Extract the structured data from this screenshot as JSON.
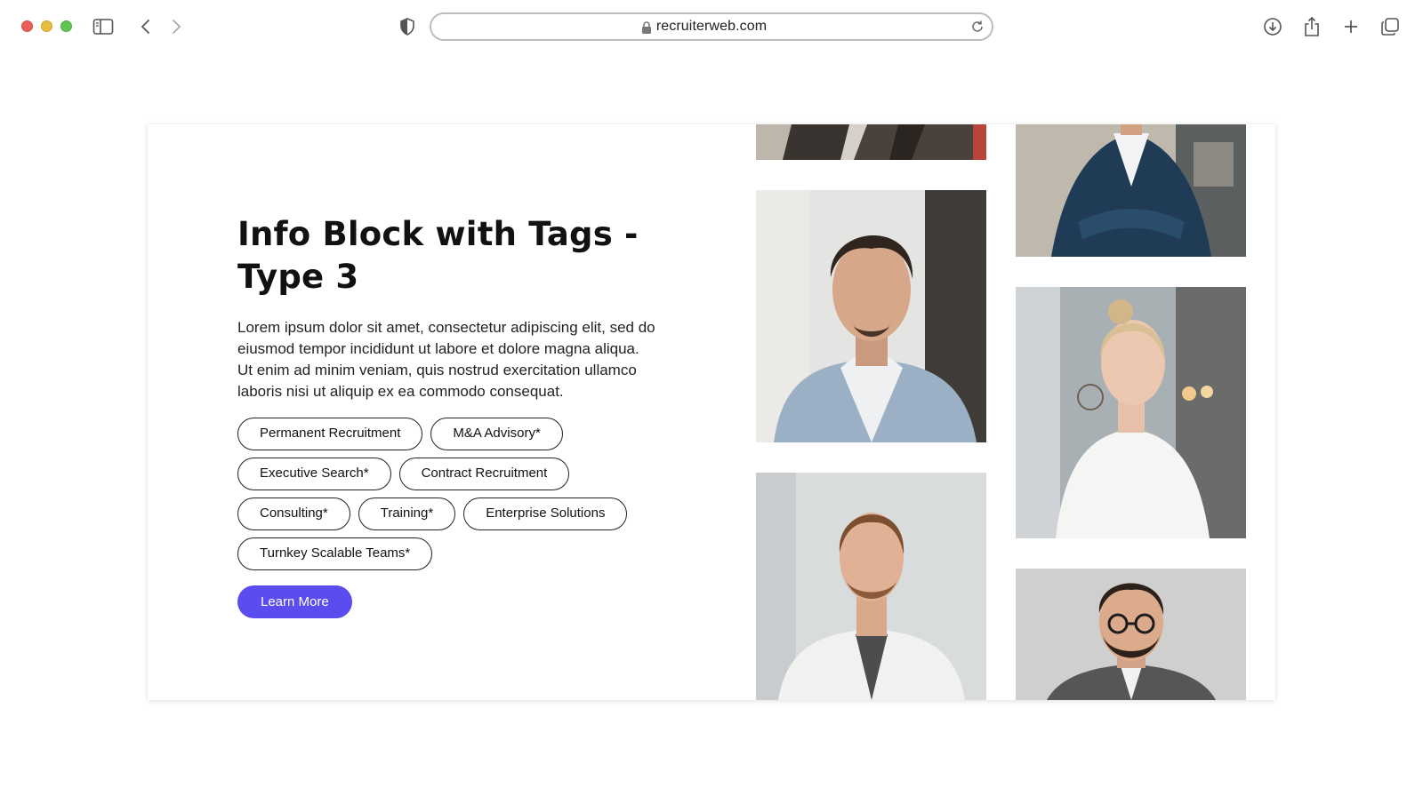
{
  "browser": {
    "url": "recruiterweb.com"
  },
  "info_block": {
    "title_line1": "Info Block with Tags -",
    "title_line2": "Type 3",
    "description": "Lorem ipsum dolor sit amet, consectetur adipiscing elit, sed do eiusmod tempor incididunt ut labore et dolore magna aliqua. Ut enim ad minim veniam, quis nostrud exercitation ullamco laboris nisi ut aliquip ex ea commodo consequat.",
    "tags": [
      "Permanent Recruitment",
      "M&A Advisory*",
      "Executive Search*",
      "Contract Recruitment",
      "Consulting*",
      "Training*",
      "Enterprise Solutions",
      "Turnkey Scalable Teams*"
    ],
    "cta_label": "Learn More"
  },
  "colors": {
    "accent": "#5b4cf0",
    "tag_border": "#222222"
  }
}
